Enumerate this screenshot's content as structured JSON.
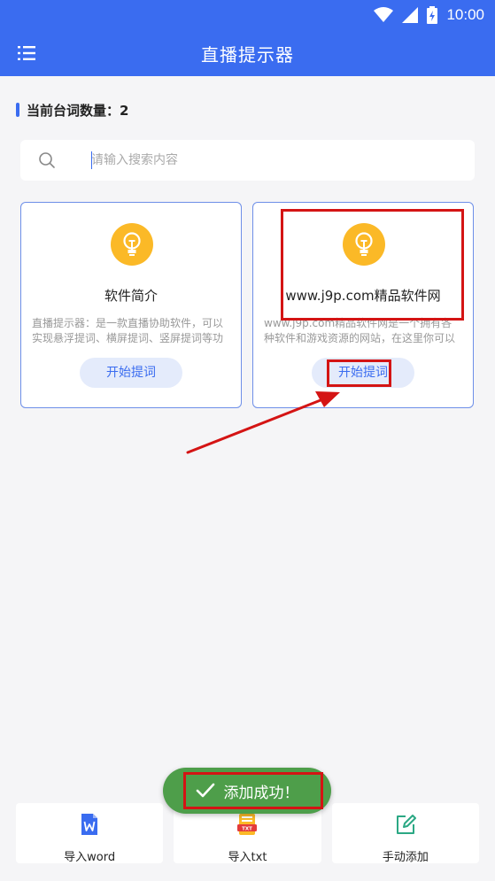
{
  "status_bar": {
    "time": "10:00",
    "icons": [
      "wifi-icon",
      "signal-icon",
      "battery-charging-icon"
    ]
  },
  "app_bar": {
    "title": "直播提示器",
    "menu_icon": "list-menu-icon"
  },
  "script_count": {
    "label": "当前台词数量：2"
  },
  "search": {
    "placeholder": "请输入搜索内容",
    "icon": "search-icon"
  },
  "cards": [
    {
      "title": "软件简介",
      "description": "直播提示器：是一款直播协助软件，可以实现悬浮提词、横屏提词、竖屏提词等功能",
      "button_label": "开始提词",
      "icon": "lightbulb-icon"
    },
    {
      "title": "www.j9p.com精品软件网",
      "description": "www.j9p.com精品软件网是一个拥有各种软件和游戏资源的网站，在这里你可以找到各类资源",
      "button_label": "开始提词",
      "icon": "lightbulb-icon"
    }
  ],
  "bottom_bar": [
    {
      "label": "导入word",
      "icon": "word-file-icon"
    },
    {
      "label": "导入txt",
      "icon": "txt-file-icon"
    },
    {
      "label": "手动添加",
      "icon": "edit-icon"
    }
  ],
  "toast": {
    "message": "添加成功！",
    "icon": "check-icon"
  },
  "colors": {
    "primary": "#3a6cf0",
    "bulb": "#fbb927",
    "toast": "#4e9e4a",
    "annotation": "#d41414"
  }
}
